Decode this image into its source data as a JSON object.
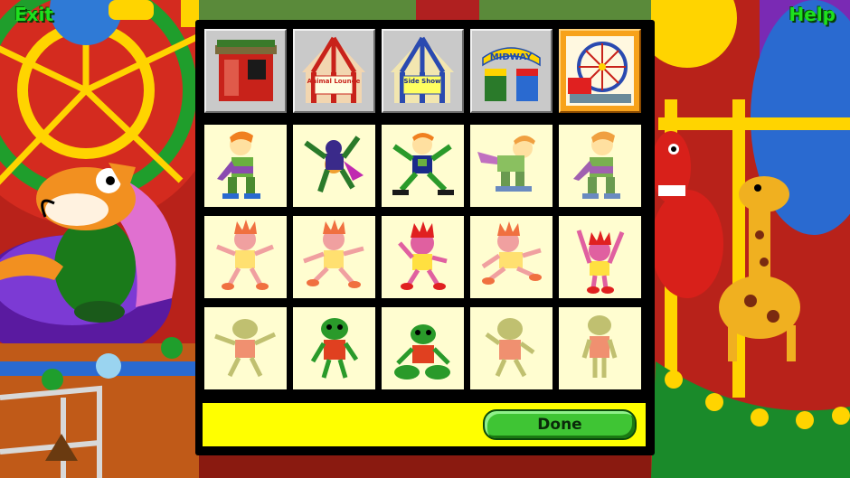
{
  "nav": {
    "exit_label": "Exit",
    "help_label": "Help"
  },
  "categories": [
    {
      "name": "building",
      "sign": ""
    },
    {
      "name": "animal-lounge-tent",
      "sign": "Animal Lounge"
    },
    {
      "name": "side-show-tent",
      "sign": "Side Show"
    },
    {
      "name": "midway-gate",
      "sign": "MIDWAY"
    },
    {
      "name": "ferris-wheel",
      "sign": ""
    }
  ],
  "selected_category": 4,
  "grid": [
    [
      "purple-hero-skater",
      "purple-hero-skater",
      "purple-hero-skater",
      "purple-hero-skater",
      "purple-hero-skater"
    ],
    [
      "flame-hair-kid",
      "flame-hair-kid",
      "flame-hair-kid",
      "flame-hair-kid",
      "flame-hair-kid"
    ],
    [
      "green-alien-kid",
      "green-alien-kid",
      "green-alien-kid",
      "green-alien-kid",
      "green-alien-kid"
    ]
  ],
  "footer": {
    "done_label": "Done"
  },
  "colors": {
    "panel_border": "#000000",
    "cell_bg": "#fffdd0",
    "footer_bg": "#ffff00",
    "done_button": "#3fc534",
    "corner_text": "#1ee01e"
  }
}
